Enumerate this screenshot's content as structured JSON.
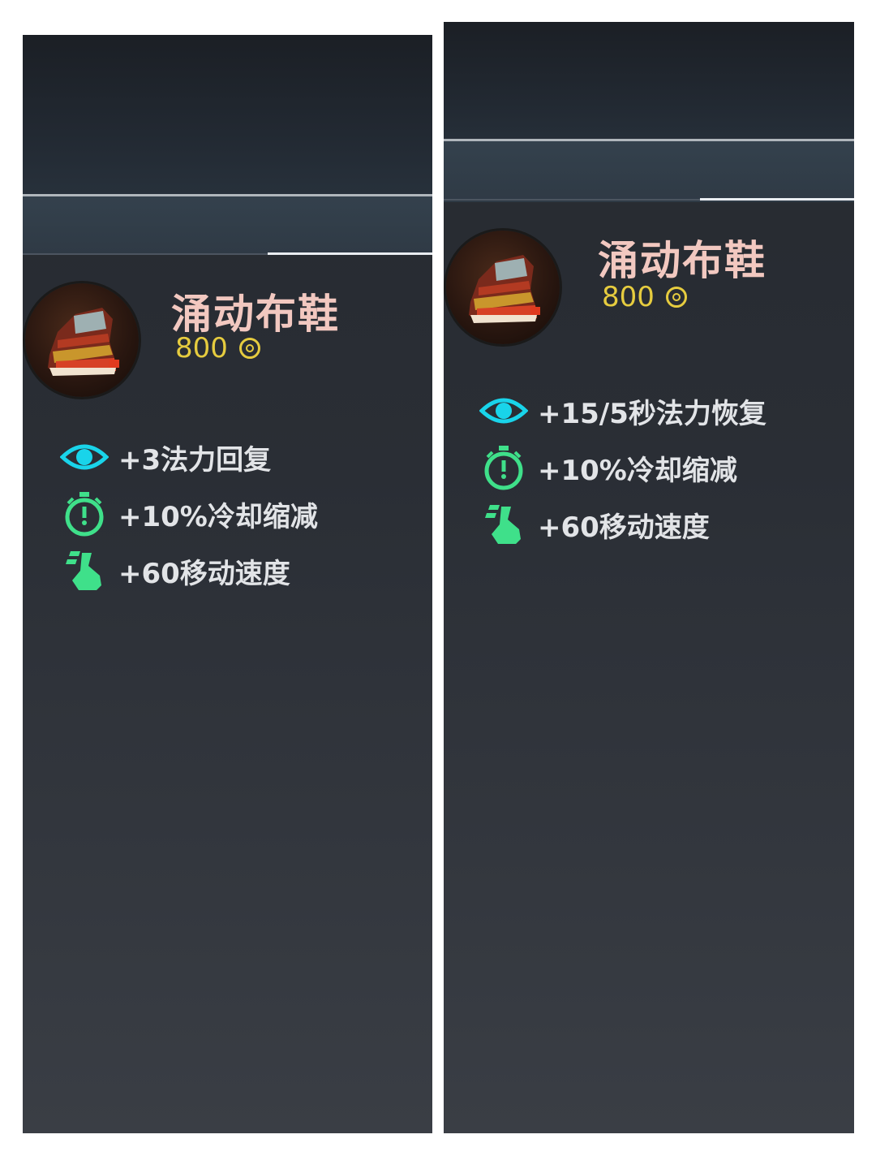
{
  "panels": [
    {
      "item_name": "涌动布鞋",
      "price": "800",
      "stats": [
        {
          "icon": "eye-icon",
          "text": "+3法力回复"
        },
        {
          "icon": "stopwatch-icon",
          "text": "+10%冷却缩减"
        },
        {
          "icon": "boot-icon",
          "text": "+60移动速度"
        }
      ]
    },
    {
      "item_name": "涌动布鞋",
      "price": "800",
      "stats": [
        {
          "icon": "eye-icon",
          "text": "+15/5秒法力恢复"
        },
        {
          "icon": "stopwatch-icon",
          "text": "+10%冷却缩减"
        },
        {
          "icon": "boot-icon",
          "text": "+60移动速度"
        }
      ]
    }
  ],
  "colors": {
    "item_name": "#f2c8c0",
    "price": "#e6cc3f",
    "eye_icon": "#19d4ea",
    "stat_icons": "#3fe08a",
    "stat_text": "#e2e4e7"
  }
}
